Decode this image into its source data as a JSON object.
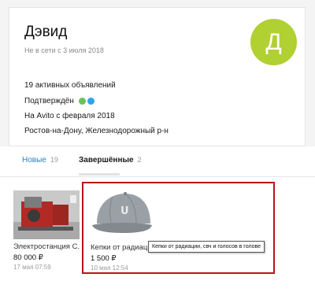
{
  "profile": {
    "name": "Дэвид",
    "last_seen": "Не в сети с 3 июля 2018",
    "avatar_letter": "Д",
    "avatar_color": "#b1d032",
    "active_ads": "19 активных объявлений",
    "confirmed": "Подтверждён",
    "confirmed_icons": [
      "phone-icon",
      "mail-icon"
    ],
    "on_avito": "На Avito с февраля 2018",
    "location": "Ростов-на-Дону, Железнодорожный р-н"
  },
  "tabs": [
    {
      "label": "Новые",
      "count": "19"
    },
    {
      "label": "Завершённые",
      "count": "2"
    }
  ],
  "listings": [
    {
      "title": "Электростанция С...",
      "price": "80 000 ₽",
      "date": "17 мая 07:59"
    },
    {
      "title": "Кепки от радиации",
      "price": "1 500 ₽",
      "date": "10 мая 12:54"
    }
  ],
  "tooltip": "Кепки от радиации, свч и голосов в голове",
  "colors": {
    "accent_link": "#2a82c6",
    "highlight": "#b8141c"
  }
}
